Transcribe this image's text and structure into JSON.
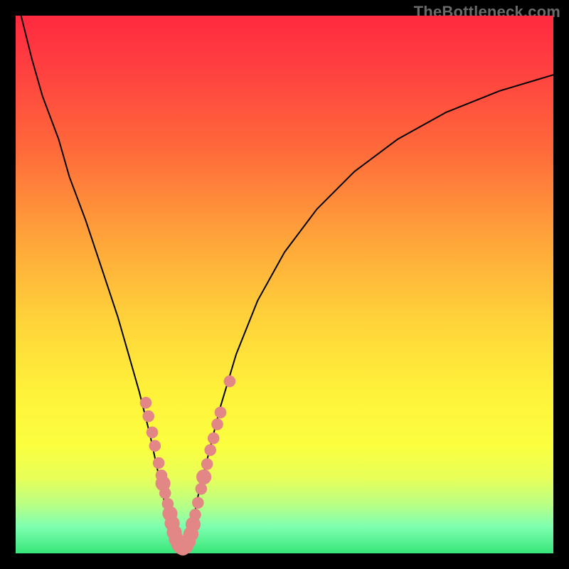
{
  "watermark": "TheBottleneck.com",
  "colors": {
    "dot": "#e38686",
    "curve": "#000000"
  },
  "chart_data": {
    "type": "line",
    "title": "",
    "xlabel": "",
    "ylabel": "",
    "xlim": [
      0,
      100
    ],
    "ylim": [
      0,
      100
    ],
    "series": [
      {
        "name": "bottleneck-curve",
        "x": [
          1,
          3,
          5,
          8,
          10,
          13,
          16,
          19,
          21,
          23,
          25,
          26.5,
          28,
          29.5,
          30.5,
          32,
          33,
          34,
          36,
          38,
          41,
          45,
          50,
          56,
          63,
          71,
          80,
          90,
          100
        ],
        "y": [
          100,
          92,
          85,
          77,
          70,
          62,
          53,
          44,
          37,
          30,
          22,
          15,
          8,
          2,
          1,
          2,
          6,
          11,
          19,
          27,
          37,
          47,
          56,
          64,
          71,
          77,
          82,
          86,
          89
        ]
      }
    ],
    "scatter": {
      "name": "measured-points",
      "points": [
        {
          "x": 24.2,
          "y": 28.0,
          "r": 1.1
        },
        {
          "x": 24.7,
          "y": 25.5,
          "r": 1.1
        },
        {
          "x": 25.4,
          "y": 22.5,
          "r": 1.1
        },
        {
          "x": 25.9,
          "y": 20.0,
          "r": 1.1
        },
        {
          "x": 26.6,
          "y": 16.8,
          "r": 1.1
        },
        {
          "x": 27.1,
          "y": 14.5,
          "r": 1.1
        },
        {
          "x": 27.4,
          "y": 13.0,
          "r": 1.4
        },
        {
          "x": 27.8,
          "y": 11.2,
          "r": 1.1
        },
        {
          "x": 28.3,
          "y": 9.2,
          "r": 1.1
        },
        {
          "x": 28.7,
          "y": 7.4,
          "r": 1.4
        },
        {
          "x": 29.1,
          "y": 5.6,
          "r": 1.4
        },
        {
          "x": 29.5,
          "y": 3.9,
          "r": 1.4
        },
        {
          "x": 29.9,
          "y": 2.6,
          "r": 1.4
        },
        {
          "x": 30.3,
          "y": 1.7,
          "r": 1.4
        },
        {
          "x": 30.7,
          "y": 1.2,
          "r": 1.4
        },
        {
          "x": 31.1,
          "y": 1.0,
          "r": 1.4
        },
        {
          "x": 31.6,
          "y": 1.3,
          "r": 1.4
        },
        {
          "x": 32.1,
          "y": 2.2,
          "r": 1.4
        },
        {
          "x": 32.6,
          "y": 3.6,
          "r": 1.4
        },
        {
          "x": 33.0,
          "y": 5.4,
          "r": 1.4
        },
        {
          "x": 33.4,
          "y": 7.2,
          "r": 1.1
        },
        {
          "x": 33.9,
          "y": 9.4,
          "r": 1.1
        },
        {
          "x": 34.5,
          "y": 12.0,
          "r": 1.1
        },
        {
          "x": 35.0,
          "y": 14.2,
          "r": 1.4
        },
        {
          "x": 35.6,
          "y": 16.6,
          "r": 1.1
        },
        {
          "x": 36.2,
          "y": 19.2,
          "r": 1.1
        },
        {
          "x": 36.8,
          "y": 21.4,
          "r": 1.1
        },
        {
          "x": 37.5,
          "y": 24.0,
          "r": 1.1
        },
        {
          "x": 38.1,
          "y": 26.2,
          "r": 1.1
        },
        {
          "x": 39.8,
          "y": 32.0,
          "r": 1.1
        }
      ]
    }
  }
}
